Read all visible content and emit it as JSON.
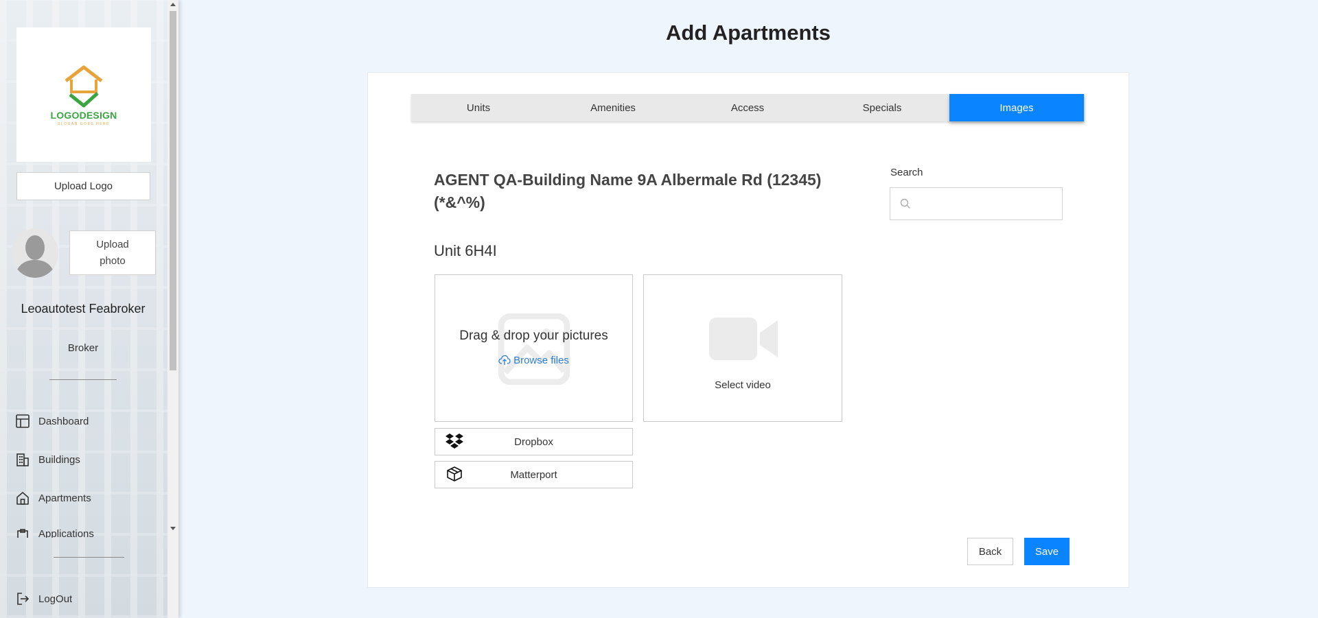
{
  "page": {
    "title": "Add Apartments"
  },
  "colors": {
    "accent": "#0a84ff",
    "link": "#2e7fd1",
    "logo_green": "#3aa541",
    "logo_orange": "#e8a43a"
  },
  "sidebar": {
    "logo": {
      "text": "LOGODESIGN",
      "tagline": "SLOGAN GOES HERE"
    },
    "upload_logo_label": "Upload Logo",
    "upload_photo_label": "Upload photo",
    "user": {
      "name": "Leoautotest Feabroker",
      "role": "Broker"
    },
    "nav": [
      {
        "label": "Dashboard",
        "icon": "dashboard-icon"
      },
      {
        "label": "Buildings",
        "icon": "buildings-icon"
      },
      {
        "label": "Apartments",
        "icon": "home-icon"
      },
      {
        "label": "Applications",
        "icon": "clipboard-icon"
      }
    ],
    "logout_label": "LogOut"
  },
  "tabs": [
    {
      "label": "Units",
      "active": false
    },
    {
      "label": "Amenities",
      "active": false
    },
    {
      "label": "Access",
      "active": false
    },
    {
      "label": "Specials",
      "active": false
    },
    {
      "label": "Images",
      "active": true
    }
  ],
  "building": {
    "title": "AGENT QA-Building Name 9A Albermale Rd (12345) (*&^%)"
  },
  "search": {
    "label": "Search",
    "value": "",
    "placeholder": ""
  },
  "unit": {
    "title": "Unit 6H4I"
  },
  "upload": {
    "drop_text": "Drag & drop your pictures",
    "browse_label": "Browse files",
    "video_label": "Select video",
    "dropbox_label": "Dropbox",
    "matterport_label": "Matterport"
  },
  "actions": {
    "back_label": "Back",
    "save_label": "Save"
  }
}
